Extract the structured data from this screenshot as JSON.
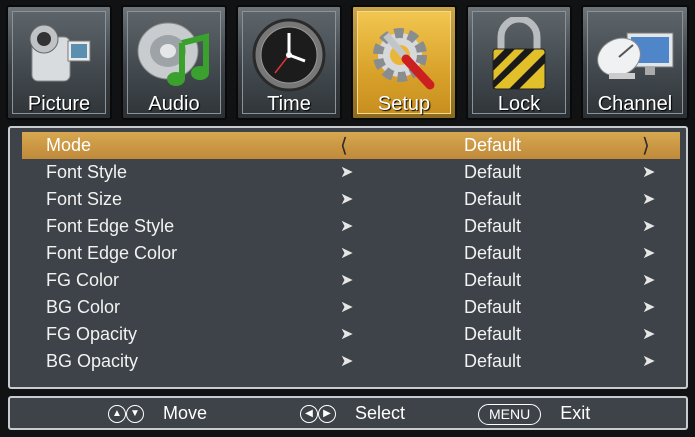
{
  "tabs": [
    {
      "label": "Picture",
      "icon": "camcorder-icon",
      "active": false
    },
    {
      "label": "Audio",
      "icon": "music-note-icon",
      "active": false
    },
    {
      "label": "Time",
      "icon": "clock-icon",
      "active": false
    },
    {
      "label": "Setup",
      "icon": "gear-wrench-icon",
      "active": true
    },
    {
      "label": "Lock",
      "icon": "padlock-icon",
      "active": false
    },
    {
      "label": "Channel",
      "icon": "satellite-dish-icon",
      "active": false
    }
  ],
  "menu": {
    "rows": [
      {
        "name": "Mode",
        "value": "Default",
        "selected": true
      },
      {
        "name": "Font Style",
        "value": "Default"
      },
      {
        "name": "Font Size",
        "value": "Default"
      },
      {
        "name": "Font Edge Style",
        "value": "Default"
      },
      {
        "name": "Font Edge Color",
        "value": "Default"
      },
      {
        "name": "FG Color",
        "value": "Default"
      },
      {
        "name": "BG Color",
        "value": "Default"
      },
      {
        "name": "FG Opacity",
        "value": "Default"
      },
      {
        "name": "BG Opacity",
        "value": "Default"
      }
    ]
  },
  "footer": {
    "move_label": "Move",
    "select_label": "Select",
    "menu_key": "MENU",
    "exit_label": "Exit"
  },
  "colors": {
    "accent": "#d7a750",
    "active_tab": "#f1c650",
    "panel": "#3d4348"
  }
}
